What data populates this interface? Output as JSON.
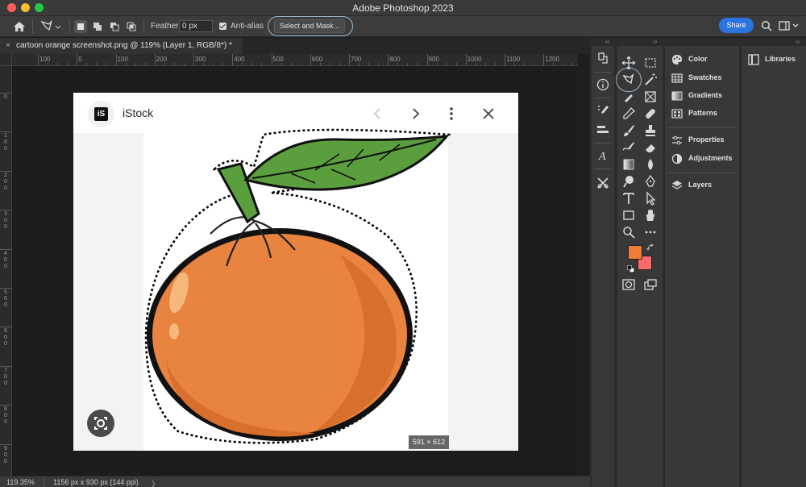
{
  "app": {
    "title": "Adobe Photoshop 2023"
  },
  "options_bar": {
    "feather_label": "Feather:",
    "feather_value": "0 px",
    "antialias_label": "Anti-alias",
    "antialias_checked": true,
    "select_mask_label": "Select and Mask...",
    "share_label": "Share",
    "selection_modes": [
      "new-selection",
      "add-to-selection",
      "subtract-from-selection",
      "intersect-with-selection"
    ]
  },
  "document": {
    "tab_close": "×",
    "tab_title": "cartoon orange screenshot.png @ 119% (Layer 1, RGB/8*) *",
    "hruler_labels": [
      "100",
      "0",
      "100",
      "200",
      "300",
      "400",
      "500",
      "600",
      "700",
      "800",
      "900",
      "1000",
      "1100",
      "1200",
      "1"
    ],
    "vruler_labels": [
      "0",
      "100",
      "200",
      "300",
      "400",
      "500",
      "600",
      "700",
      "800",
      "900"
    ]
  },
  "image_content": {
    "brand_logo_text": "iS",
    "brand_name": "iStock",
    "dimensions_badge": "591 × 612",
    "colors": {
      "orange": "#e8843f",
      "orange_dark": "#d96f2c",
      "leaf": "#5a9e3e",
      "outline": "#111111"
    }
  },
  "status_bar": {
    "zoom": "119.35%",
    "doc_info": "1156 px x 930 px (144 ppi)",
    "arrow": "〉"
  },
  "colors": {
    "foreground": "#f07c33",
    "background": "#f96b6b",
    "accent": "#2b74e0"
  },
  "panels": {
    "items": [
      {
        "label": "Color",
        "icon": "color-palette-icon"
      },
      {
        "label": "Swatches",
        "icon": "swatches-grid-icon"
      },
      {
        "label": "Gradients",
        "icon": "gradient-icon"
      },
      {
        "label": "Patterns",
        "icon": "patterns-icon"
      },
      {
        "label": "Properties",
        "icon": "sliders-icon"
      },
      {
        "label": "Adjustments",
        "icon": "adjustments-icon"
      },
      {
        "label": "Layers",
        "icon": "layers-icon"
      }
    ],
    "libraries_label": "Libraries"
  }
}
